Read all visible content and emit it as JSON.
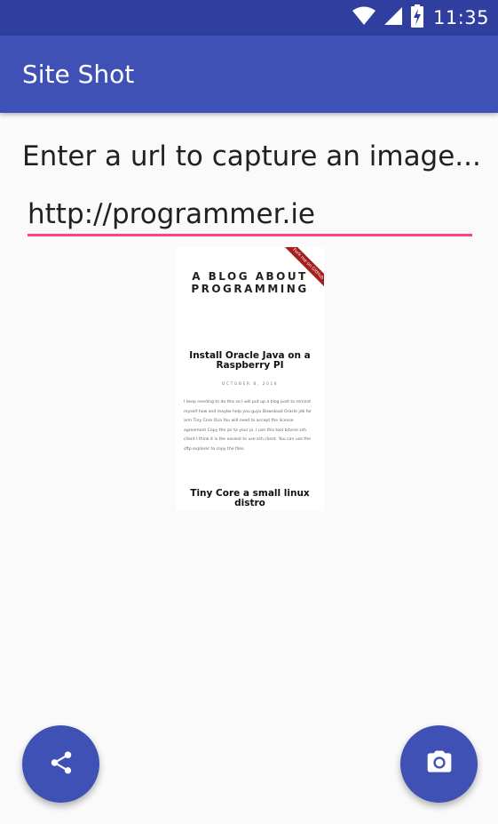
{
  "status_bar": {
    "time": "11:35",
    "icons": [
      "wifi-icon",
      "signal-icon",
      "battery-charging-icon"
    ]
  },
  "app_bar": {
    "title": "Site Shot"
  },
  "main": {
    "prompt": "Enter a url to capture an image...",
    "url_input": {
      "value": "http://programmer.ie",
      "placeholder": ""
    },
    "preview": {
      "ribbon": "Fork me on GitHub",
      "blog_title": "A BLOG ABOUT PROGRAMMING",
      "post1_title": "Install Oracle Java on a Raspberry PI",
      "post1_date": "OCTOBER 8, 2016",
      "post1_body": "I keep needing to do this so I will put up a blog post to remind myself how and maybe help you guys Download Oracle jdk for arm Tiny Core Ova You will need to accept the license agreement Copy the jar to your pi. I use this tool bitvise ssh client I think it is the easiest to use ssh client. You can use the sftp explorer to copy the files.",
      "post2_title": "Tiny Core a small linux distro"
    }
  },
  "fabs": {
    "share_icon": "share-icon",
    "camera_icon": "camera-icon"
  },
  "colors": {
    "status_bar": "#303f9f",
    "primary": "#3f51b5",
    "accent": "#ff4081",
    "background": "#fafafa"
  }
}
